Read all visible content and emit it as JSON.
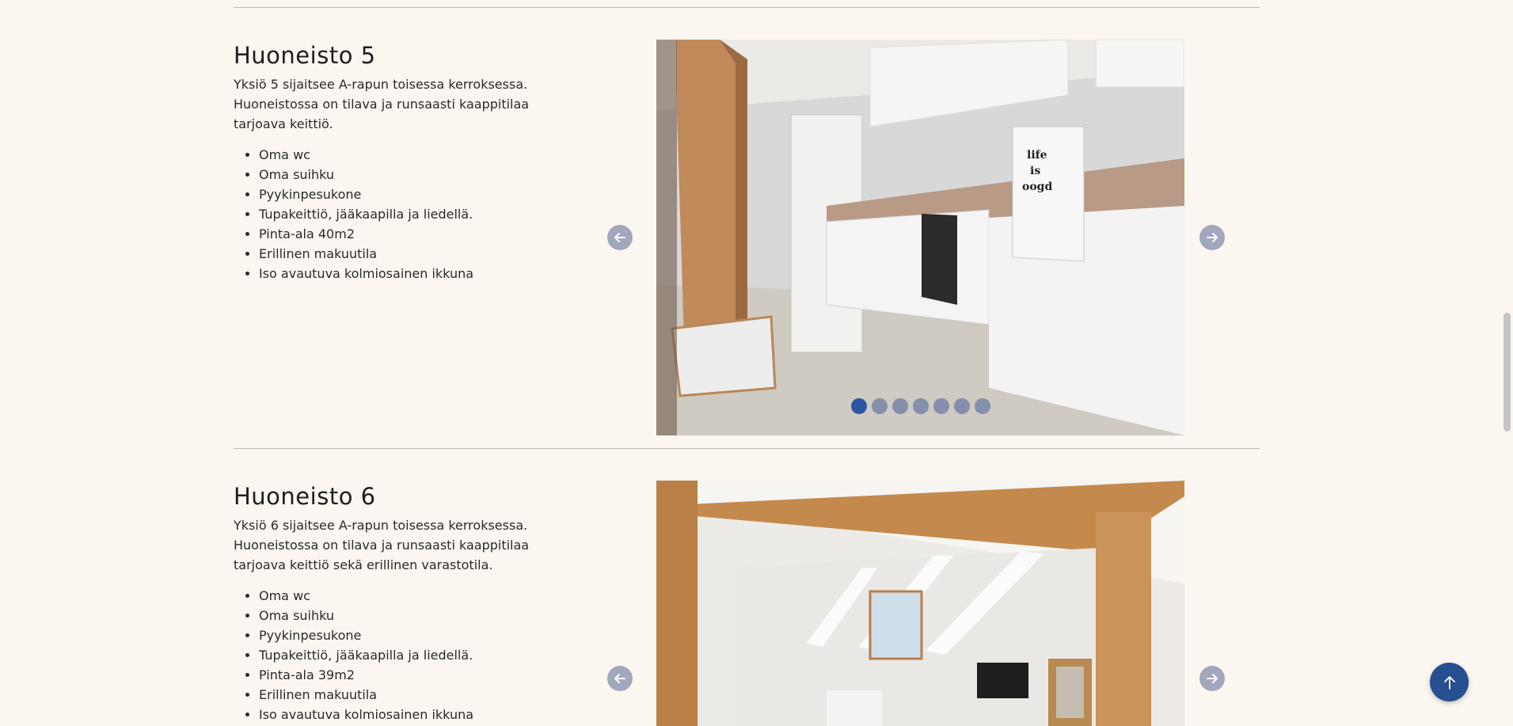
{
  "units": [
    {
      "title": "Huoneisto 5",
      "description": "Yksiö 5 sijaitsee A-rapun toisessa kerroksessa. Huoneistossa on tilava ja runsaasti kaappitilaa tarjoava keittiö.",
      "features": [
        "Oma wc",
        "Oma suihku",
        "Pyykinpesukone",
        "Tupakeittiö, jääkaapilla ja liedellä.",
        "Pinta-ala 40m2",
        "Erillinen makuutila",
        "Iso avautuva kolmiosainen ikkuna"
      ],
      "slides": 7,
      "active_slide": 1,
      "fridge_text": [
        "life",
        "is",
        "oogd"
      ]
    },
    {
      "title": "Huoneisto 6",
      "description": "Yksiö 6 sijaitsee A-rapun toisessa kerroksessa. Huoneistossa on tilava ja runsaasti kaappitilaa tarjoava keittiö sekä erillinen varastotila.",
      "features": [
        "Oma wc",
        "Oma suihku",
        "Pyykinpesukone",
        "Tupakeittiö, jääkaapilla ja liedellä.",
        "Pinta-ala 39m2",
        "Erillinen makuutila",
        "Iso avautuva kolmiosainen ikkuna"
      ]
    }
  ],
  "icons": {
    "prev": "arrow-left-icon",
    "next": "arrow-right-icon",
    "scroll_top": "arrow-up-icon"
  },
  "colors": {
    "background": "#fbf6ef",
    "nav_button": "#a1a7bc",
    "dot_active": "#2c56a3",
    "dot_inactive": "#7b88a8",
    "scroll_top": "#254f8f"
  }
}
